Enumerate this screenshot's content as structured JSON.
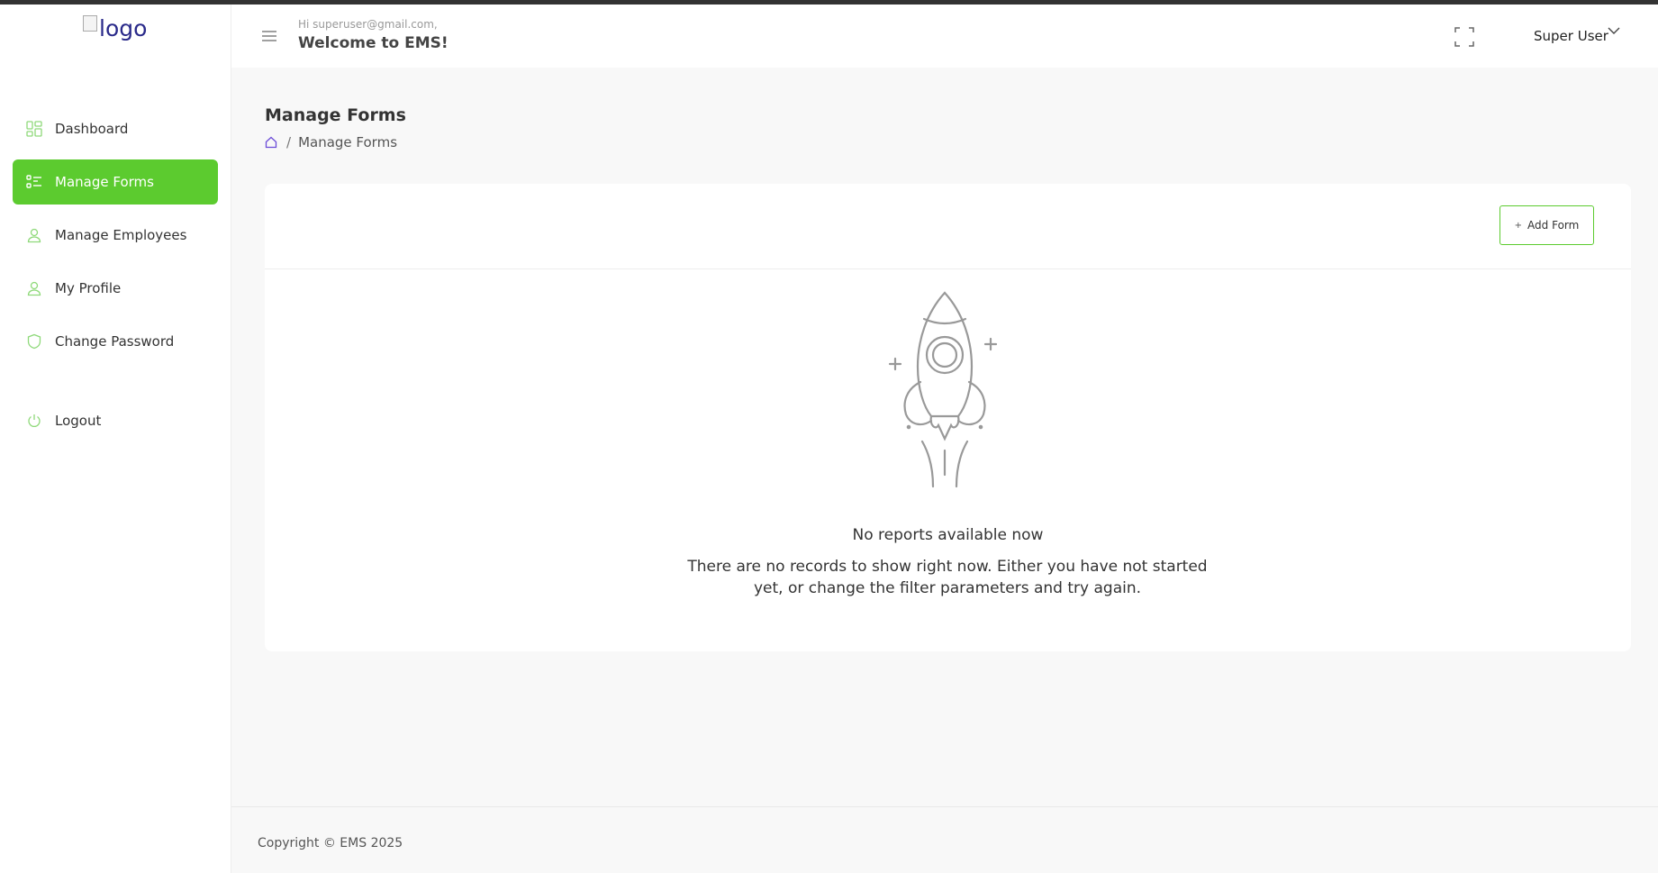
{
  "sidebar": {
    "logo_alt": "logo",
    "items": [
      {
        "label": "Dashboard",
        "icon": "dashboard-icon",
        "active": false
      },
      {
        "label": "Manage Forms",
        "icon": "forms-icon",
        "active": true
      },
      {
        "label": "Manage Employees",
        "icon": "user-icon",
        "active": false
      },
      {
        "label": "My Profile",
        "icon": "user-icon",
        "active": false
      },
      {
        "label": "Change Password",
        "icon": "shield-icon",
        "active": false
      },
      {
        "label": "Logout",
        "icon": "power-icon",
        "active": false
      }
    ]
  },
  "header": {
    "greeting": "Hi superuser@gmail.com,",
    "welcome": "Welcome to EMS!",
    "user_name": "Super User"
  },
  "page": {
    "title": "Manage Forms",
    "breadcrumb": [
      "Manage Forms"
    ]
  },
  "card": {
    "add_label": "Add Form",
    "empty_title": "No reports available now",
    "empty_desc": "There are no records to show right now. Either you have not started yet, or change the filter parameters and try again."
  },
  "footer": {
    "copyright": "Copyright © EMS 2025"
  },
  "colors": {
    "accent": "#5ccb2f",
    "icon_tint": "#8fd97a"
  }
}
